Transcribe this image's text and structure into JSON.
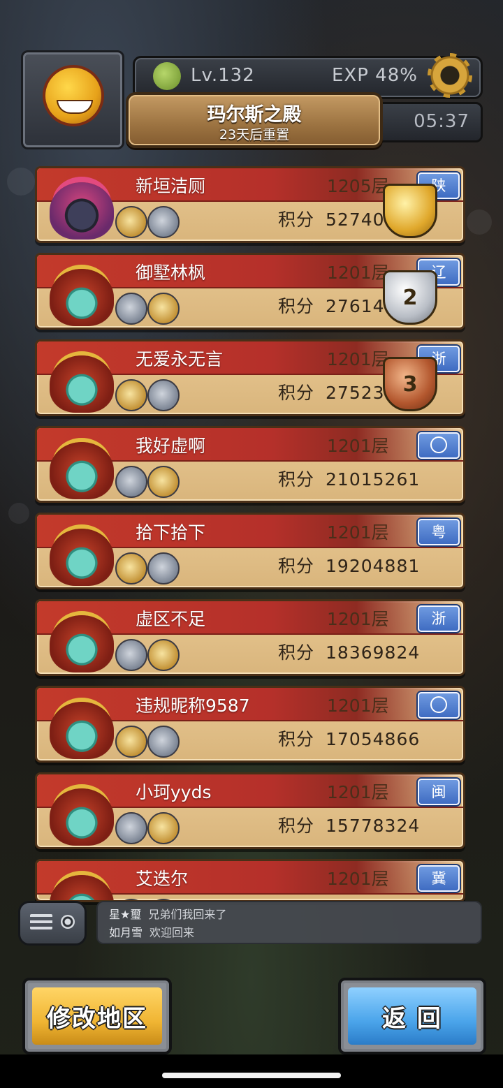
{
  "header": {
    "level": "Lv.132",
    "exp": "EXP 48%",
    "title": "玛尔斯之殿",
    "subtitle": "23天后重置",
    "timer": "05:37"
  },
  "ranking": [
    {
      "name": "新垣洁厕",
      "floor": "1205层",
      "score_label": "积分",
      "score": "5274096",
      "region": "陕",
      "trophy": "gold",
      "trophy_text": ""
    },
    {
      "name": "御墅林枫",
      "floor": "1201层",
      "score_label": "积分",
      "score": "27614877",
      "region": "辽",
      "trophy": "silver",
      "trophy_text": "2"
    },
    {
      "name": "无爱永无言",
      "floor": "1201层",
      "score_label": "积分",
      "score": "27523816",
      "region": "浙",
      "trophy": "bronze",
      "trophy_text": "3"
    },
    {
      "name": "我好虚啊",
      "floor": "1201层",
      "score_label": "积分",
      "score": "21015261",
      "region": "",
      "trophy": "",
      "trophy_text": ""
    },
    {
      "name": "拾下拾下",
      "floor": "1201层",
      "score_label": "积分",
      "score": "19204881",
      "region": "粤",
      "trophy": "",
      "trophy_text": ""
    },
    {
      "name": "虚区不足",
      "floor": "1201层",
      "score_label": "积分",
      "score": "18369824",
      "region": "浙",
      "trophy": "",
      "trophy_text": ""
    },
    {
      "name": "违规昵称9587",
      "floor": "1201层",
      "score_label": "积分",
      "score": "17054866",
      "region": "",
      "trophy": "",
      "trophy_text": ""
    },
    {
      "name": "小珂yyds",
      "floor": "1201层",
      "score_label": "积分",
      "score": "15778324",
      "region": "闽",
      "trophy": "",
      "trophy_text": ""
    },
    {
      "name": "艾迭尔",
      "floor": "1201层",
      "score_label": "积分",
      "score": "",
      "region": "冀",
      "trophy": "",
      "trophy_text": ""
    }
  ],
  "chat": [
    {
      "user": "星★璽",
      "message": "兄弟们我回来了"
    },
    {
      "user": "如月雪",
      "message": "欢迎回来"
    }
  ],
  "buttons": {
    "change_region": "修改地区",
    "back": "返 回"
  },
  "colors": {
    "card_band": "#c33a2b",
    "region_badge": "#4a78cc",
    "region_button": "#f0b533",
    "back_button": "#4aa4ea"
  }
}
